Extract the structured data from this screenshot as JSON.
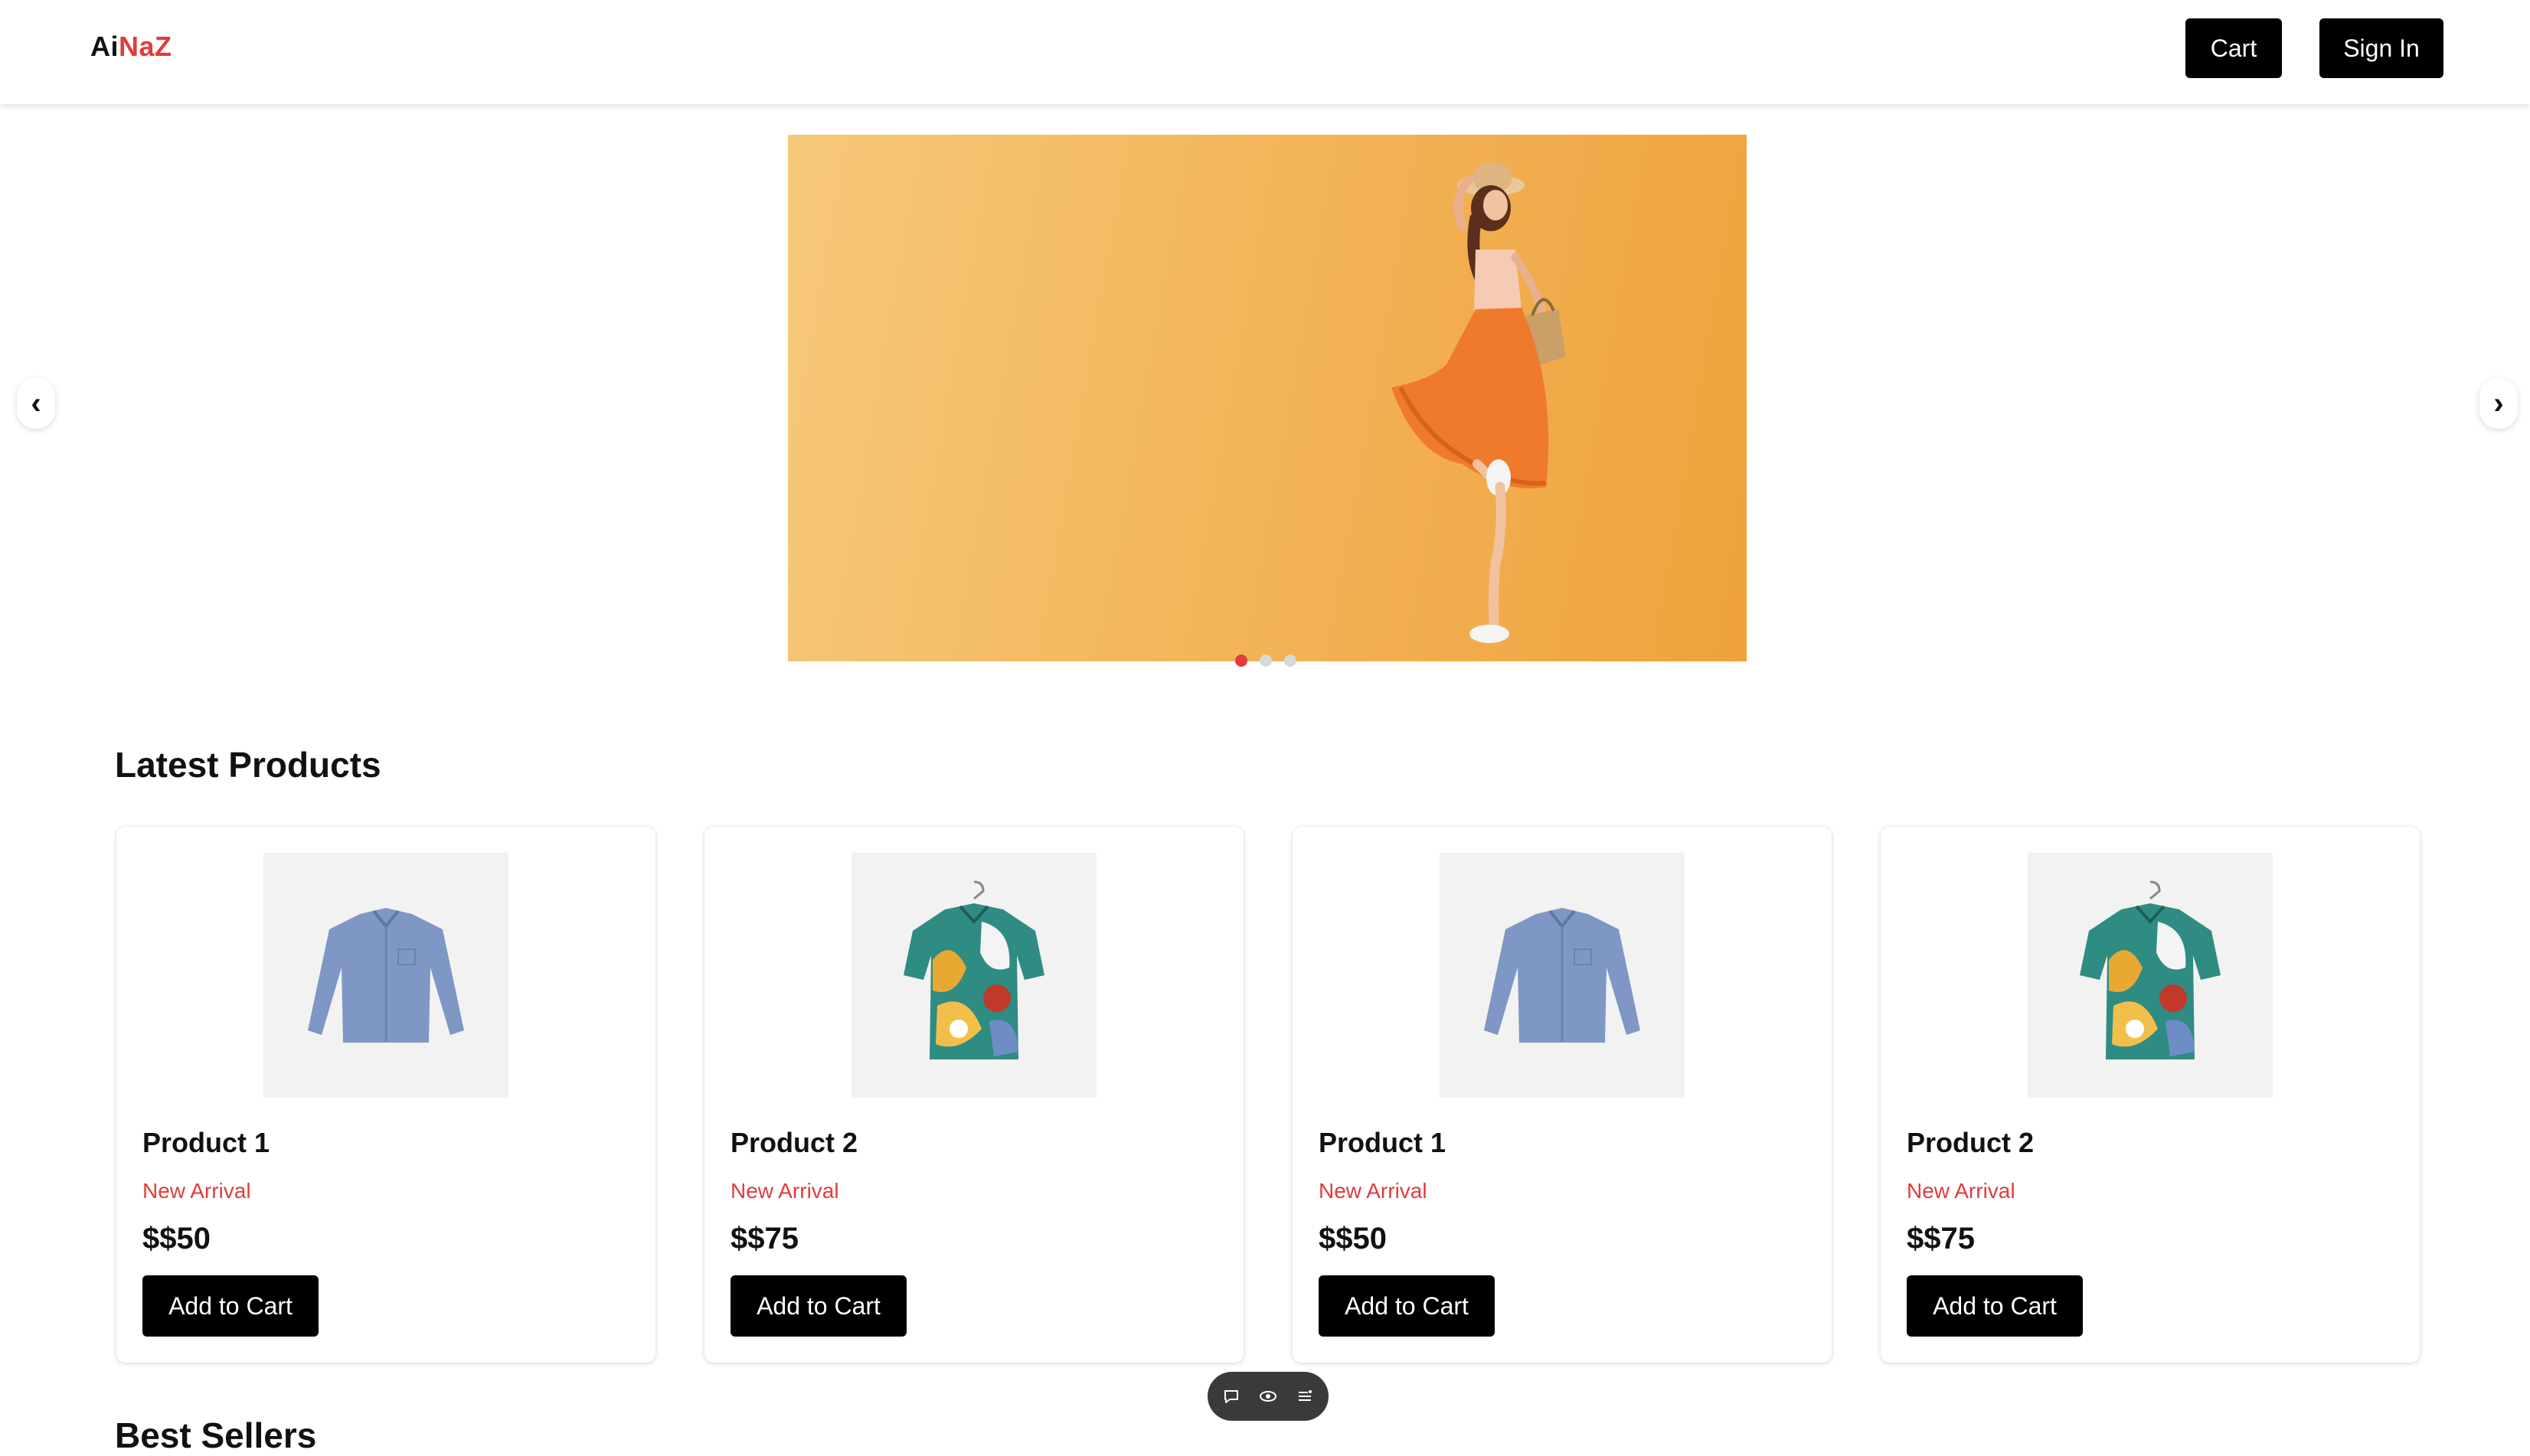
{
  "header": {
    "logo_part1": "Ai",
    "logo_part2": "NaZ",
    "cart_label": "Cart",
    "signin_label": "Sign In"
  },
  "carousel": {
    "prev_icon": "chevron-left-icon",
    "next_icon": "chevron-right-icon",
    "prev_glyph": "‹",
    "next_glyph": "›",
    "slide_count": 3,
    "active_slide": 1
  },
  "latest": {
    "title": "Latest Products",
    "products": [
      {
        "name": "Product 1",
        "tag": "New Arrival",
        "price": "$$50",
        "button": "Add to Cart",
        "image": "blue-shirt"
      },
      {
        "name": "Product 2",
        "tag": "New Arrival",
        "price": "$$75",
        "button": "Add to Cart",
        "image": "floral-shirt"
      },
      {
        "name": "Product 1",
        "tag": "New Arrival",
        "price": "$$50",
        "button": "Add to Cart",
        "image": "blue-shirt"
      },
      {
        "name": "Product 2",
        "tag": "New Arrival",
        "price": "$$75",
        "button": "Add to Cart",
        "image": "floral-shirt"
      }
    ]
  },
  "best": {
    "title": "Best Sellers"
  },
  "toolbar": {
    "icons": [
      "comment-icon",
      "eye-icon",
      "list-icon"
    ]
  },
  "colors": {
    "accent": "#e23b3b",
    "button_bg": "#000000",
    "hero_bg": "#f3b65b"
  }
}
